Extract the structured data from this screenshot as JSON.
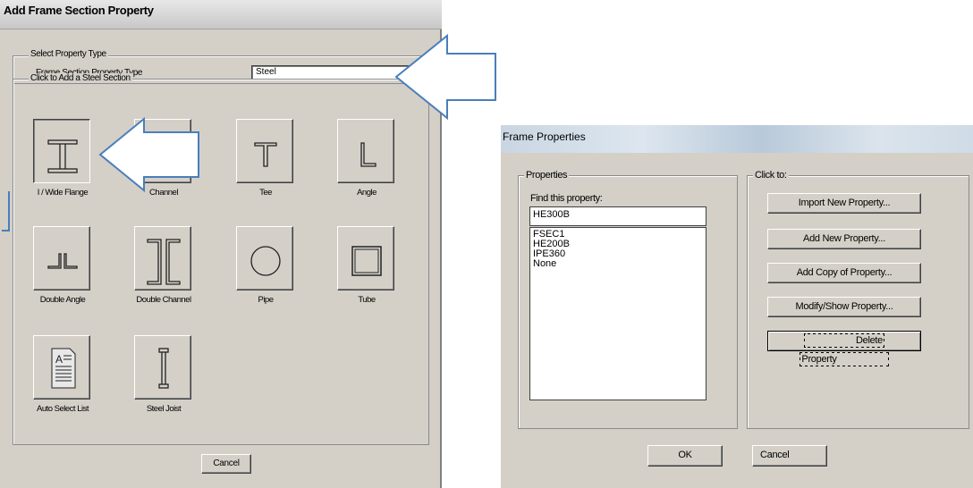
{
  "left_dialog": {
    "title": "Add Frame Section Property",
    "select_group_label": "Select Property Type",
    "property_type_label": "Frame Section Property Type",
    "property_type_value": "Steel",
    "steel_group_label": "Click to Add a Steel Section",
    "sections": [
      {
        "label": "I / Wide Flange",
        "icon": "i-wide-flange-icon"
      },
      {
        "label": "Channel",
        "icon": "channel-icon"
      },
      {
        "label": "Tee",
        "icon": "tee-icon"
      },
      {
        "label": "Angle",
        "icon": "angle-icon"
      },
      {
        "label": "Double Angle",
        "icon": "double-angle-icon"
      },
      {
        "label": "Double Channel",
        "icon": "double-channel-icon"
      },
      {
        "label": "Pipe",
        "icon": "pipe-icon"
      },
      {
        "label": "Tube",
        "icon": "tube-icon"
      },
      {
        "label": "Auto Select List",
        "icon": "auto-select-list-icon"
      },
      {
        "label": "Steel Joist",
        "icon": "steel-joist-icon"
      }
    ],
    "cancel_label": "Cancel"
  },
  "right_dialog": {
    "title": "Frame Properties",
    "properties_group_label": "Properties",
    "find_label": "Find this property:",
    "find_value": "HE300B",
    "list_items": [
      "FSEC1",
      "HE200B",
      "IPE360",
      "None"
    ],
    "click_group_label": "Click to:",
    "buttons": {
      "import": "Import New Property...",
      "add_new": "Add New Property...",
      "add_copy": "Add Copy of Property...",
      "modify": "Modify/Show Property...",
      "delete": "Delete Property"
    },
    "ok_label": "OK",
    "cancel_label": "Cancel"
  },
  "colors": {
    "dialog_bg": "#d4d0c8",
    "arrow_stroke": "#4a7ebb"
  }
}
